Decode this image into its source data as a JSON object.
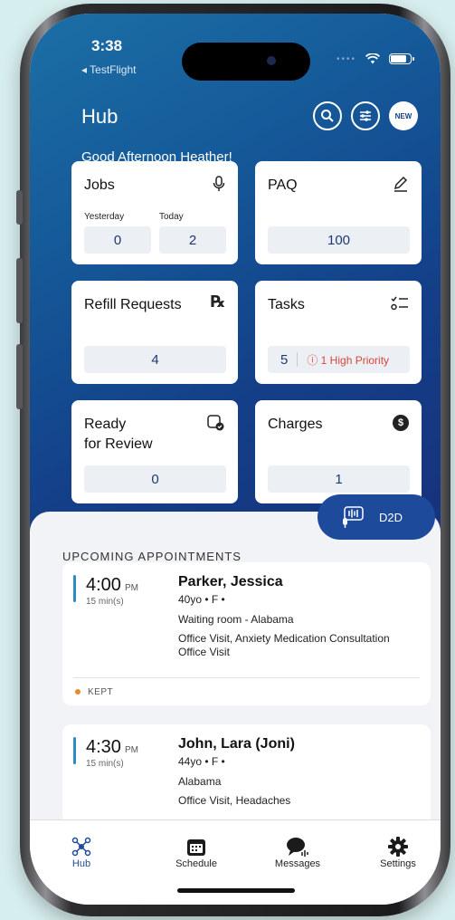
{
  "status_bar": {
    "time": "3:38",
    "back_app": "◂ TestFlight"
  },
  "header": {
    "title": "Hub",
    "new_badge": "NEW"
  },
  "greeting": "Good Afternoon Heather!",
  "tiles": {
    "jobs": {
      "title": "Jobs",
      "icon": "microphone-icon",
      "yesterday_label": "Yesterday",
      "today_label": "Today",
      "yesterday_value": "0",
      "today_value": "2"
    },
    "paq": {
      "title": "PAQ",
      "icon": "pencil-icon",
      "value": "100"
    },
    "refill": {
      "title": "Refill Requests",
      "icon": "rx-icon",
      "icon_text": "℞",
      "value": "4"
    },
    "tasks": {
      "title": "Tasks",
      "icon": "checklist-icon",
      "value": "5",
      "priority": "ⓘ 1 High Priority"
    },
    "review": {
      "title_line1": "Ready",
      "title_line2": "for Review",
      "icon": "document-check-icon",
      "value": "0"
    },
    "charges": {
      "title": "Charges",
      "icon": "dollar-icon",
      "icon_text": "$",
      "value": "1"
    }
  },
  "d2d": {
    "label": "D2D",
    "icon": "voice-record-icon"
  },
  "appointments": {
    "title": "UPCOMING APPOINTMENTS",
    "items": [
      {
        "time": "4:00",
        "ampm": "PM",
        "duration": "15 min(s)",
        "name": "Parker, Jessica",
        "demo": "40yo • F •",
        "location": "Waiting room - Alabama",
        "reason": "Office Visit, Anxiety Medication Consultation Office Visit",
        "status": "KEPT"
      },
      {
        "time": "4:30",
        "ampm": "PM",
        "duration": "15 min(s)",
        "name": "John, Lara (Joni)",
        "demo": "44yo • F •",
        "location": "Alabama",
        "reason": "Office Visit, Headaches"
      }
    ]
  },
  "tabs": [
    {
      "label": "Hub",
      "icon": "hub-icon"
    },
    {
      "label": "Schedule",
      "icon": "calendar-icon"
    },
    {
      "label": "Messages",
      "icon": "messages-icon"
    },
    {
      "label": "Settings",
      "icon": "gear-icon"
    }
  ],
  "colors": {
    "brand": "#1d4a9a",
    "accent_bar": "#2c8cc4",
    "priority_red": "#d6473b",
    "kept_orange": "#e8892c"
  }
}
